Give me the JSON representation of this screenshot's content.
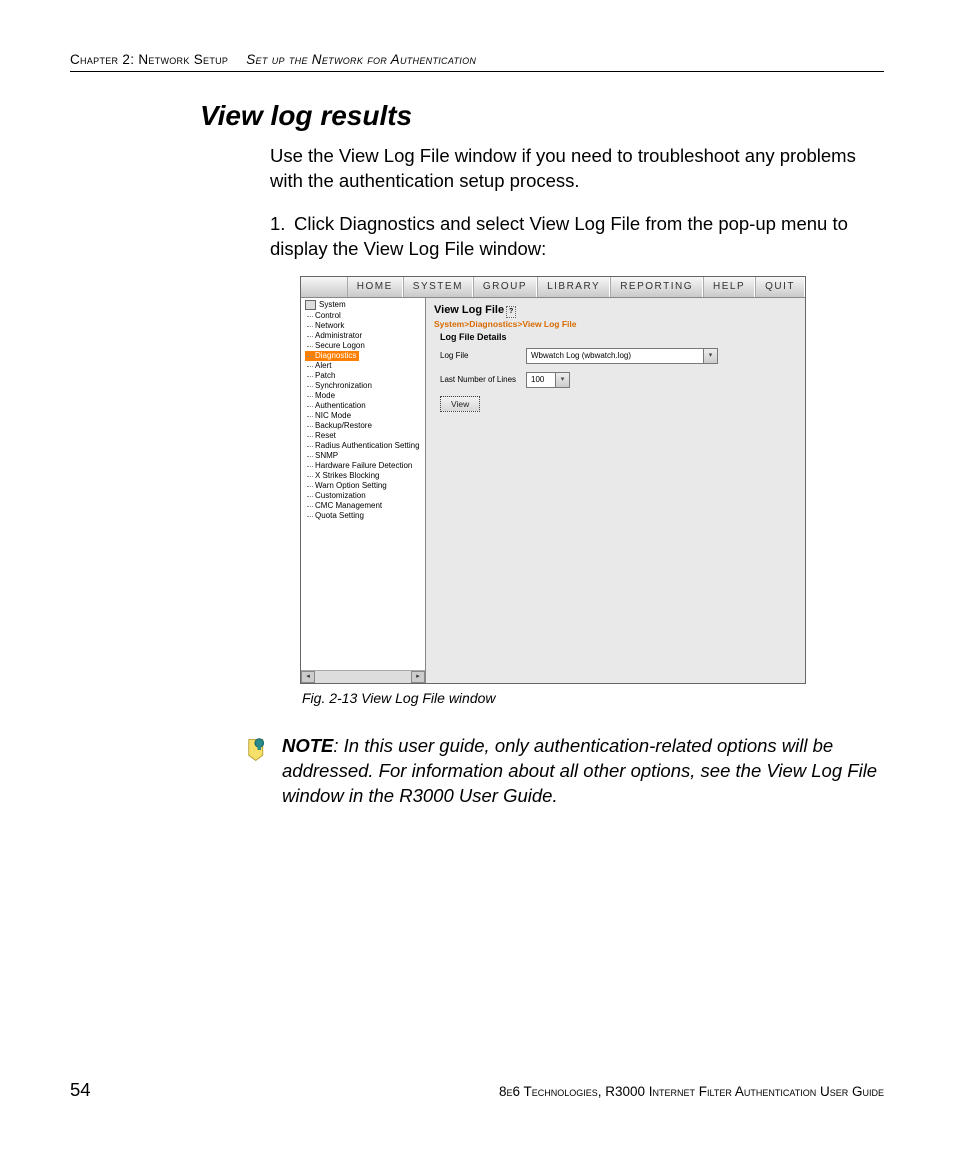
{
  "header": {
    "chapter": "Chapter 2: Network Setup",
    "section": "Set up the Network for Authentication"
  },
  "title": "View log results",
  "intro": "Use the View Log File window if you need to troubleshoot any problems with the authentication setup process.",
  "step1": "Click Diagnostics and select View Log File from the pop-up menu to display the View Log File window:",
  "step1_num": "1.",
  "menubar": {
    "home": "HOME",
    "system": "SYSTEM",
    "group": "GROUP",
    "library": "LIBRARY",
    "reporting": "REPORTING",
    "help": "HELP",
    "quit": "QUIT"
  },
  "tree": {
    "root": "System",
    "items": [
      "Control",
      "Network",
      "Administrator",
      "Secure Logon",
      "Diagnostics",
      "Alert",
      "Patch",
      "Synchronization",
      "Mode",
      "Authentication",
      "NIC Mode",
      "Backup/Restore",
      "Reset",
      "Radius Authentication Setting",
      "SNMP",
      "Hardware Failure Detection",
      "X Strikes Blocking",
      "Warn Option Setting",
      "Customization",
      "CMC Management",
      "Quota Setting"
    ]
  },
  "content": {
    "title": "View Log File",
    "help_glyph": "?",
    "breadcrumb": "System>Diagnostics>View Log File",
    "subheading": "Log File Details",
    "logfile_label": "Log File",
    "logfile_value": "Wbwatch Log (wbwatch.log)",
    "lines_label": "Last Number of Lines",
    "lines_value": "100",
    "view_button": "View"
  },
  "caption": "Fig. 2-13  View Log File window",
  "note": {
    "label": "NOTE",
    "text": ": In this user guide, only authentication-related options will be addressed. For information about all other options, see the View Log File window in the R3000 User Guide."
  },
  "footer": {
    "page": "54",
    "text": "8e6 Technologies, R3000 Internet Filter Authentication User Guide"
  }
}
